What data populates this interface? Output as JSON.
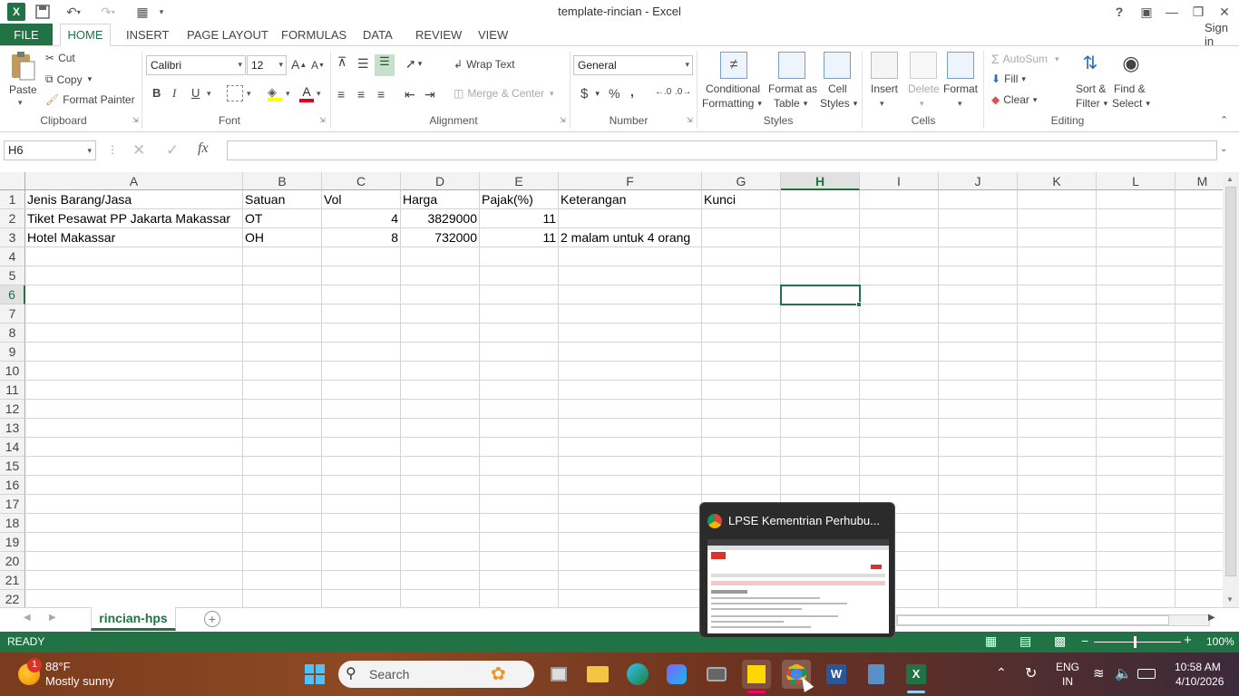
{
  "window": {
    "title": "template-rincian - Excel",
    "signin": "Sign in",
    "help": "?",
    "min": "—",
    "restore": "❐",
    "close": "✕"
  },
  "tabs": {
    "file": "FILE",
    "items": [
      "HOME",
      "INSERT",
      "PAGE LAYOUT",
      "FORMULAS",
      "DATA",
      "REVIEW",
      "VIEW"
    ]
  },
  "ribbon": {
    "clipboard": {
      "paste": "Paste",
      "cut": "Cut",
      "copy": "Copy",
      "format_painter": "Format Painter",
      "label": "Clipboard"
    },
    "font": {
      "name": "Calibri",
      "size": "12",
      "bold": "B",
      "italic": "I",
      "underline": "U",
      "label": "Font"
    },
    "alignment": {
      "wrap": "Wrap Text",
      "merge": "Merge & Center",
      "label": "Alignment"
    },
    "number": {
      "format": "General",
      "currency": "$",
      "percent": "%",
      "comma": ",",
      "label": "Number"
    },
    "styles": {
      "conditional": "Conditional",
      "conditional2": "Formatting",
      "table": "Format as",
      "table2": "Table",
      "cell": "Cell",
      "cell2": "Styles",
      "label": "Styles"
    },
    "cells": {
      "insert": "Insert",
      "delete": "Delete",
      "format": "Format",
      "label": "Cells"
    },
    "editing": {
      "autosum": "AutoSum",
      "fill": "Fill",
      "clear": "Clear",
      "sort": "Sort &",
      "sort2": "Filter",
      "find": "Find &",
      "find2": "Select",
      "label": "Editing"
    }
  },
  "formula_bar": {
    "name_box": "H6",
    "fx": "fx",
    "value": ""
  },
  "columns": [
    "A",
    "B",
    "C",
    "D",
    "E",
    "F",
    "G",
    "H",
    "I",
    "J",
    "K",
    "L",
    "M"
  ],
  "rows": [
    "1",
    "2",
    "3",
    "4",
    "5",
    "6",
    "7",
    "8",
    "9",
    "10",
    "11",
    "12",
    "13",
    "14",
    "15",
    "16",
    "17",
    "18",
    "19",
    "20",
    "21",
    "22"
  ],
  "cells": {
    "A1": "Jenis Barang/Jasa",
    "B1": "Satuan",
    "C1": "Vol",
    "D1": "Harga",
    "E1": "Pajak(%)",
    "F1": "Keterangan",
    "G1": "Kunci",
    "A2": "Tiket Pesawat PP Jakarta Makassar",
    "B2": "OT",
    "C2": "4",
    "D2": "3829000",
    "E2": "11",
    "A3": "Hotel Makassar",
    "B3": "OH",
    "C3": "8",
    "D3": "732000",
    "E3": "11",
    "F3": "2 malam untuk 4 orang"
  },
  "sheet": {
    "tab": "rincian-hps"
  },
  "status": {
    "ready": "READY",
    "zoom": "100%"
  },
  "taskbar": {
    "weather_temp": "88°F",
    "weather_desc": "Mostly sunny",
    "weather_badge": "1",
    "search": "Search",
    "lang1": "ENG",
    "lang2": "IN",
    "time": "10:58 AM",
    "date": "4/10/2026"
  },
  "thumbnail": {
    "title": "LPSE Kementrian Perhubu..."
  }
}
